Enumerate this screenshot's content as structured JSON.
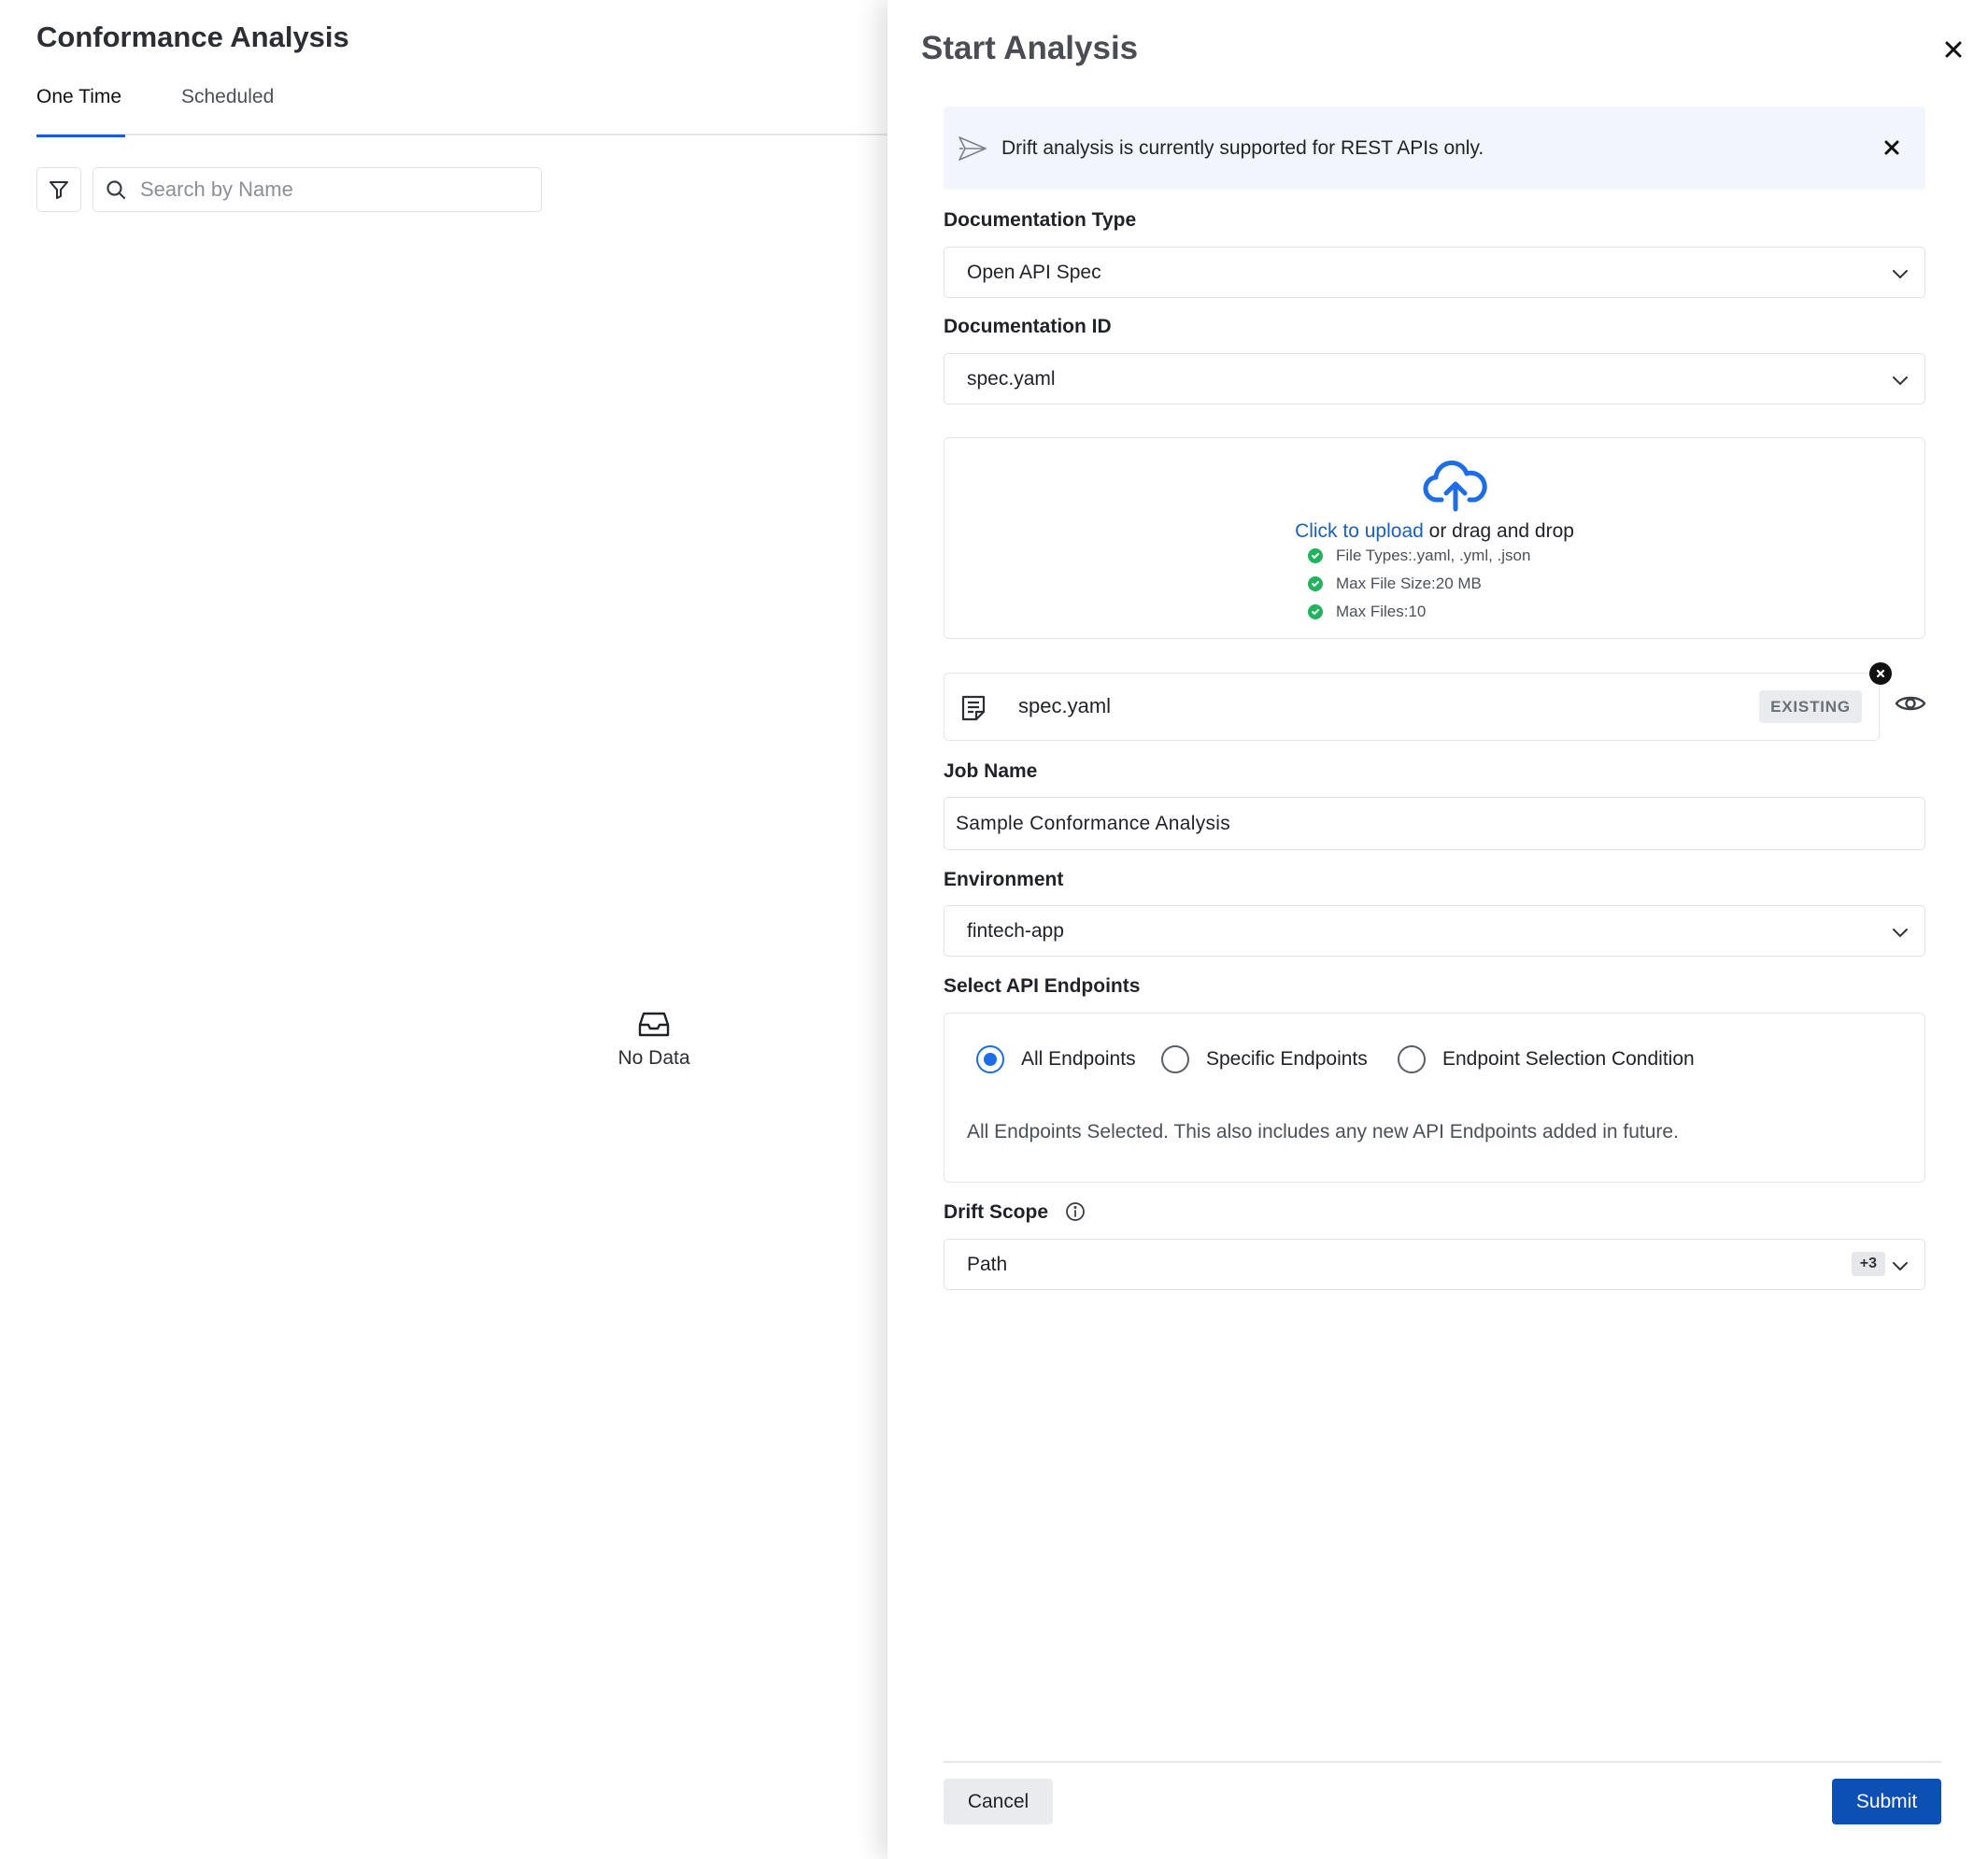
{
  "page": {
    "title": "Conformance Analysis",
    "tabs": [
      {
        "label": "One Time",
        "active": true
      },
      {
        "label": "Scheduled",
        "active": false
      }
    ],
    "filter_icon": "filter-icon",
    "search": {
      "placeholder": "Search by Name",
      "value": ""
    },
    "empty_state": {
      "icon": "inbox-icon",
      "label": "No Data"
    }
  },
  "drawer": {
    "title": "Start Analysis",
    "close_icon": "close-icon",
    "banner": {
      "icon": "drift-icon",
      "text": "Drift analysis is currently supported for REST APIs only."
    },
    "documentation_type": {
      "label": "Documentation Type",
      "value": "Open API Spec"
    },
    "documentation_id": {
      "label": "Documentation ID",
      "value": "spec.yaml"
    },
    "upload": {
      "icon": "cloud-upload-icon",
      "link": "Click to upload",
      "rest": " or drag and drop",
      "requirements": [
        {
          "key": "File Types:",
          "value": " .yaml, .yml, .json"
        },
        {
          "key": "Max File Size:",
          "value": " 20 MB"
        },
        {
          "key": "Max Files:",
          "value": " 10"
        }
      ]
    },
    "file": {
      "name": "spec.yaml",
      "badge": "EXISTING",
      "icon": "document-icon",
      "remove_icon": "remove-icon",
      "view_icon": "eye-icon"
    },
    "job_name": {
      "label": "Job Name",
      "value": "Sample Conformance Analysis"
    },
    "environment": {
      "label": "Environment",
      "value": "fintech-app"
    },
    "endpoints": {
      "label": "Select API Endpoints",
      "options": [
        {
          "label": "All Endpoints",
          "checked": true
        },
        {
          "label": "Specific Endpoints",
          "checked": false
        },
        {
          "label": "Endpoint Selection Condition",
          "checked": false
        }
      ],
      "note": "All Endpoints Selected. This also includes any new API Endpoints added in future."
    },
    "drift_scope": {
      "label": "Drift Scope",
      "value": "Path",
      "extra_count": "+3"
    },
    "actions": {
      "cancel": "Cancel",
      "submit": "Submit"
    },
    "colors": {
      "accent": "#1d6ee6",
      "primary_button": "#0c4fb5",
      "link": "#1b5fc2",
      "success": "#22b35e"
    }
  }
}
